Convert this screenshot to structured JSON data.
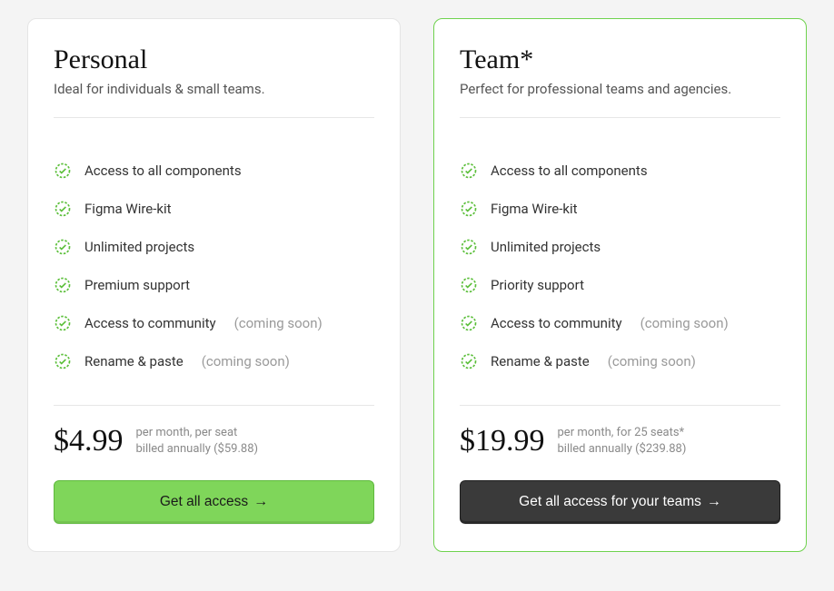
{
  "plans": [
    {
      "name": "Personal",
      "subtitle": "Ideal for individuals & small teams.",
      "features": [
        {
          "label": "Access to all components",
          "tag": ""
        },
        {
          "label": "Figma Wire-kit",
          "tag": ""
        },
        {
          "label": "Unlimited projects",
          "tag": ""
        },
        {
          "label": "Premium support",
          "tag": ""
        },
        {
          "label": "Access to community",
          "tag": "(coming soon)"
        },
        {
          "label": "Rename & paste",
          "tag": "(coming soon)"
        }
      ],
      "price": "$4.99",
      "price_line1": "per month, per seat",
      "price_line2": "billed annually ($59.88)",
      "cta": "Get all access",
      "cta_style": "green"
    },
    {
      "name": "Team*",
      "subtitle": "Perfect for professional teams and agencies.",
      "features": [
        {
          "label": "Access to all components",
          "tag": ""
        },
        {
          "label": "Figma Wire-kit",
          "tag": ""
        },
        {
          "label": "Unlimited projects",
          "tag": ""
        },
        {
          "label": "Priority support",
          "tag": ""
        },
        {
          "label": "Access to community",
          "tag": "(coming soon)"
        },
        {
          "label": "Rename & paste",
          "tag": "(coming soon)"
        }
      ],
      "price": "$19.99",
      "price_line1": "per month, for 25 seats*",
      "price_line2": "billed annually ($239.88)",
      "cta": "Get all access for your teams",
      "cta_style": "dark"
    }
  ],
  "arrow": "→"
}
